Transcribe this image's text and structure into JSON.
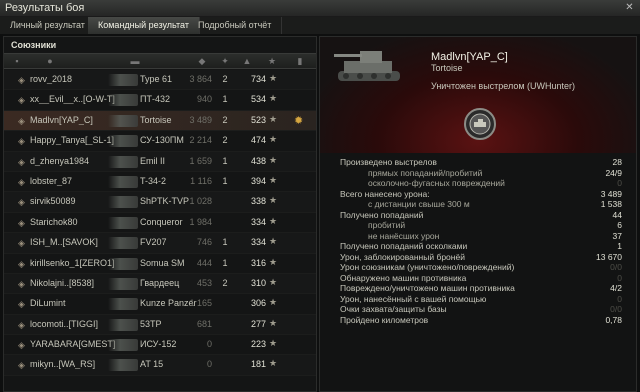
{
  "window": {
    "title": "Результаты боя",
    "close": "✕"
  },
  "tabs": [
    {
      "label": "Личный результат",
      "active": false
    },
    {
      "label": "Командный результат",
      "active": true
    },
    {
      "label": "Подробный отчёт",
      "active": false
    }
  ],
  "team": {
    "label": "Союзники",
    "rows": [
      {
        "name": "rovv_2018",
        "tank": "Type 61",
        "damage": "3 864",
        "kills": "2",
        "xp": "734",
        "player": false
      },
      {
        "name": "xx__Evil__x..[O-W-T]",
        "tank": "ПТ-432",
        "damage": "940",
        "kills": "1",
        "xp": "534",
        "player": false
      },
      {
        "name": "Madlvn[YAP_C]",
        "tank": "Tortoise",
        "damage": "3 489",
        "kills": "2",
        "xp": "523",
        "player": true
      },
      {
        "name": "Happy_Tanya[_SL-1]",
        "tank": "СУ-130ПМ",
        "damage": "2 214",
        "kills": "2",
        "xp": "474",
        "player": false
      },
      {
        "name": "d_zhenya1984",
        "tank": "Emil II",
        "damage": "1 659",
        "kills": "1",
        "xp": "438",
        "player": false
      },
      {
        "name": "lobster_87",
        "tank": "T-34-2",
        "damage": "1 116",
        "kills": "1",
        "xp": "394",
        "player": false
      },
      {
        "name": "sirvik50089",
        "tank": "ShPTK-TVP",
        "damage": "1 028",
        "kills": "",
        "xp": "338",
        "player": false
      },
      {
        "name": "Starichok80",
        "tank": "Conqueror",
        "damage": "1 984",
        "kills": "",
        "xp": "334",
        "player": false
      },
      {
        "name": "ISH_M..[SAVOK]",
        "tank": "FV207",
        "damage": "746",
        "kills": "1",
        "xp": "334",
        "player": false
      },
      {
        "name": "kirillsenko_1[ZERO1]",
        "tank": "Somua SM",
        "damage": "444",
        "kills": "1",
        "xp": "316",
        "player": false
      },
      {
        "name": "Nikolajni..[8538]",
        "tank": "Гвардеец",
        "damage": "453",
        "kills": "2",
        "xp": "310",
        "player": false
      },
      {
        "name": "DiLumint",
        "tank": "Kunze Panzer",
        "damage": "1 165",
        "kills": "",
        "xp": "306",
        "player": false
      },
      {
        "name": "locomoti..[TIGGI]",
        "tank": "53TP",
        "damage": "681",
        "kills": "",
        "xp": "277",
        "player": false
      },
      {
        "name": "YARABARA[GMEST]",
        "tank": "ИСУ-152",
        "damage": "0",
        "kills": "",
        "xp": "223",
        "player": false
      },
      {
        "name": "mikyn..[WA_RS]",
        "tank": "AT 15",
        "damage": "0",
        "kills": "",
        "xp": "181",
        "player": false
      }
    ]
  },
  "detail": {
    "player_name": "Madlvn[YAP_C]",
    "tank_name": "Tortoise",
    "destroyed_text": "Уничтожен выстрелом (UWHunter)",
    "stats": [
      {
        "label": "Произведено выстрелов",
        "value": "28",
        "indent": false,
        "dim": false
      },
      {
        "label": "прямых попаданий/пробитий",
        "value": "24/9",
        "indent": true,
        "dim": false
      },
      {
        "label": "осколочно-фугасных повреждений",
        "value": "0",
        "indent": true,
        "dim": true
      },
      {
        "label": "Всего нанесено урона:",
        "value": "3 489",
        "indent": false,
        "dim": false
      },
      {
        "label": "с дистанции свыше 300 м",
        "value": "1 538",
        "indent": true,
        "dim": false
      },
      {
        "label": "Получено попаданий",
        "value": "44",
        "indent": false,
        "dim": false
      },
      {
        "label": "пробитий",
        "value": "6",
        "indent": true,
        "dim": false
      },
      {
        "label": "не нанёсших урон",
        "value": "37",
        "indent": true,
        "dim": false
      },
      {
        "label": "Получено попаданий осколками",
        "value": "1",
        "indent": false,
        "dim": false
      },
      {
        "label": "Урон, заблокированный бронёй",
        "value": "13 670",
        "indent": false,
        "dim": false
      },
      {
        "label": "Урон союзникам (уничтожено/повреждений)",
        "value": "0/0",
        "indent": false,
        "dim": true
      },
      {
        "label": "Обнаружено машин противника",
        "value": "0",
        "indent": false,
        "dim": true
      },
      {
        "label": "Повреждено/уничтожено машин противника",
        "value": "4/2",
        "indent": false,
        "dim": false
      },
      {
        "label": "Урон, нанесённый с вашей помощью",
        "value": "0",
        "indent": false,
        "dim": true
      },
      {
        "label": "Очки захвата/защиты базы",
        "value": "0/0",
        "indent": false,
        "dim": true
      },
      {
        "label": "Пройдено километров",
        "value": "0,78",
        "indent": false,
        "dim": false
      }
    ]
  }
}
